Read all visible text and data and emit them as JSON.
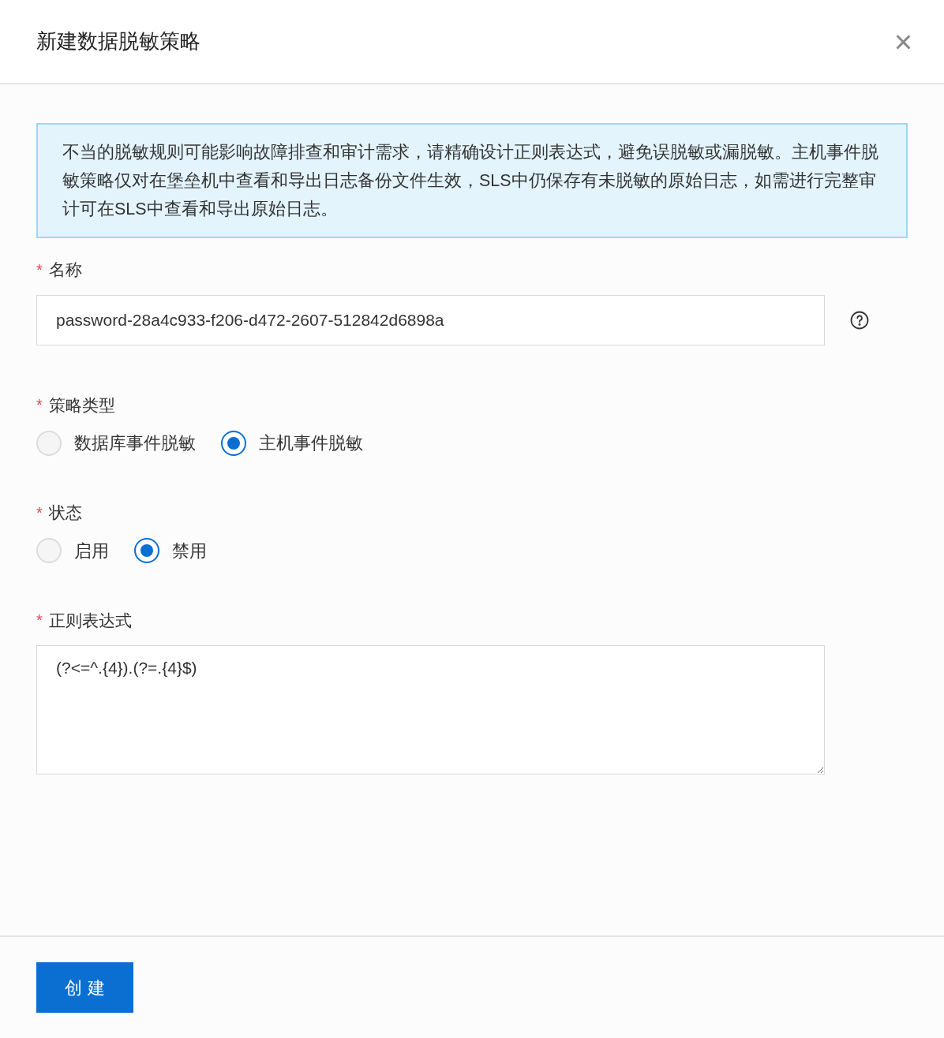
{
  "dialog": {
    "title": "新建数据脱敏策略",
    "close": "×"
  },
  "notice": "不当的脱敏规则可能影响故障排查和审计需求，请精确设计正则表达式，避免误脱敏或漏脱敏。主机事件脱敏策略仅对在堡垒机中查看和导出日志备份文件生效，SLS中仍保存有未脱敏的原始日志，如需进行完整审计可在SLS中查看和导出原始日志。",
  "fields": [
    {
      "kind": "input",
      "required_mark": "*",
      "label": "名称",
      "value": "password-28a4c933-f206-d472-2607-512842d6898a",
      "help": true
    },
    {
      "kind": "radio",
      "required_mark": "*",
      "label": "策略类型",
      "options": [
        {
          "label": "数据库事件脱敏",
          "selected": false
        },
        {
          "label": "主机事件脱敏",
          "selected": true
        }
      ]
    },
    {
      "kind": "radio",
      "required_mark": "*",
      "label": "状态",
      "options": [
        {
          "label": "启用",
          "selected": false
        },
        {
          "label": "禁用",
          "selected": true
        }
      ]
    },
    {
      "kind": "textarea",
      "required_mark": "*",
      "label": "正则表达式",
      "value": "(?<=^.{4}).(?=.{4}$)"
    }
  ],
  "footer": {
    "submit": "创 建"
  }
}
